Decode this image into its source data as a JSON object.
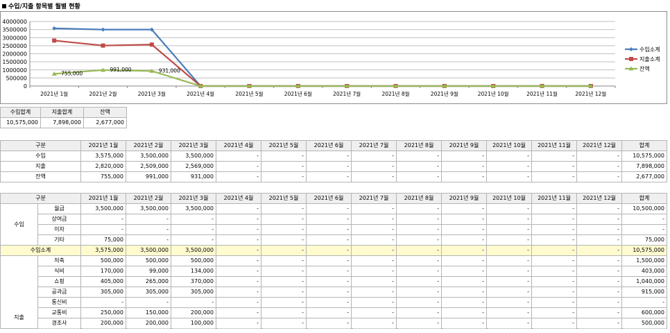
{
  "title": "수입/지출 항목별 월별 현황",
  "chart_data": {
    "type": "line",
    "categories": [
      "2021년 1월",
      "2021년 2월",
      "2021년 3월",
      "2021년 4월",
      "2021년 5월",
      "2021년 6월",
      "2021년 7월",
      "2021년 8월",
      "2021년 9월",
      "2021년 10월",
      "2021년 11월",
      "2021년 12월"
    ],
    "y_ticks": [
      "0",
      "500000",
      "1000000",
      "1500000",
      "2000000",
      "2500000",
      "3000000",
      "3500000",
      "4000000"
    ],
    "ylim": [
      0,
      4000000
    ],
    "grid": true,
    "legend_position": "right",
    "series": [
      {
        "name": "수입소계",
        "color": "#4a7ebb",
        "marker": "diamond",
        "values": [
          3575000,
          3500000,
          3500000,
          0,
          0,
          0,
          0,
          0,
          0,
          0,
          0,
          0
        ]
      },
      {
        "name": "지출소계",
        "color": "#be4b48",
        "marker": "square",
        "values": [
          2820000,
          2509000,
          2569000,
          0,
          0,
          0,
          0,
          0,
          0,
          0,
          0,
          0
        ]
      },
      {
        "name": "잔액",
        "color": "#98b954",
        "marker": "triangle",
        "values": [
          755000,
          991000,
          931000,
          0,
          0,
          0,
          0,
          0,
          0,
          0,
          0,
          0
        ]
      }
    ],
    "data_labels": [
      "755,000",
      "991,000",
      "931,000"
    ]
  },
  "summary": {
    "headers": [
      "수입합계",
      "지출합계",
      "잔액"
    ],
    "values": [
      "10,575,000",
      "7,898,000",
      "2,677,000"
    ]
  },
  "monthly": {
    "headers": [
      "구분",
      "2021년 1월",
      "2021년 2월",
      "2021년 3월",
      "2021년 4월",
      "2021년 5월",
      "2021년 6월",
      "2021년 7월",
      "2021년 8월",
      "2021년 9월",
      "2021년 10월",
      "2021년 11월",
      "2021년 12월",
      "합계"
    ],
    "rows": [
      [
        "수입",
        "3,575,000",
        "3,500,000",
        "3,500,000",
        "-",
        "-",
        "-",
        "-",
        "-",
        "-",
        "-",
        "-",
        "-",
        "10,575,000"
      ],
      [
        "지출",
        "2,820,000",
        "2,509,000",
        "2,569,000",
        "-",
        "-",
        "-",
        "-",
        "-",
        "-",
        "-",
        "-",
        "-",
        "7,898,000"
      ],
      [
        "잔액",
        "755,000",
        "991,000",
        "931,000",
        "-",
        "-",
        "-",
        "-",
        "-",
        "-",
        "-",
        "-",
        "-",
        "2,677,000"
      ]
    ]
  },
  "detail": {
    "headers": [
      "구분",
      "2021년 1월",
      "2021년 2월",
      "2021년 3월",
      "2021년 4월",
      "2021년 5월",
      "2021년 6월",
      "2021년 7월",
      "2021년 8월",
      "2021년 9월",
      "2021년 10월",
      "2021년 11월",
      "2021년 12월",
      "합계"
    ],
    "income_label": "수입",
    "income_rows": [
      [
        "월급",
        "3,500,000",
        "3,500,000",
        "3,500,000",
        "-",
        "-",
        "-",
        "-",
        "-",
        "-",
        "-",
        "-",
        "-",
        "10,500,000"
      ],
      [
        "상여금",
        "-",
        "-",
        "-",
        "-",
        "-",
        "-",
        "-",
        "-",
        "-",
        "-",
        "-",
        "-",
        "-"
      ],
      [
        "이자",
        "-",
        "-",
        "-",
        "-",
        "-",
        "-",
        "-",
        "-",
        "-",
        "-",
        "-",
        "-",
        "-"
      ],
      [
        "기타",
        "75,000",
        "-",
        "-",
        "-",
        "-",
        "-",
        "-",
        "-",
        "-",
        "-",
        "-",
        "-",
        "75,000"
      ]
    ],
    "income_subtotal": [
      "수입소계",
      "3,575,000",
      "3,500,000",
      "3,500,000",
      "-",
      "-",
      "-",
      "-",
      "-",
      "-",
      "-",
      "-",
      "-",
      "10,575,000"
    ],
    "expense_label": "지출",
    "expense_rows": [
      [
        "저축",
        "500,000",
        "500,000",
        "500,000",
        "-",
        "-",
        "-",
        "-",
        "-",
        "-",
        "-",
        "-",
        "-",
        "1,500,000"
      ],
      [
        "식비",
        "170,000",
        "99,000",
        "134,000",
        "-",
        "-",
        "-",
        "-",
        "-",
        "-",
        "-",
        "-",
        "-",
        "403,000"
      ],
      [
        "쇼핑",
        "405,000",
        "265,000",
        "370,000",
        "-",
        "-",
        "-",
        "-",
        "-",
        "-",
        "-",
        "-",
        "-",
        "1,040,000"
      ],
      [
        "공과금",
        "305,000",
        "305,000",
        "305,000",
        "-",
        "-",
        "-",
        "-",
        "-",
        "-",
        "-",
        "-",
        "-",
        "915,000"
      ],
      [
        "통신비",
        "-",
        "-",
        "-",
        "-",
        "-",
        "-",
        "-",
        "-",
        "-",
        "-",
        "-",
        "-",
        "-"
      ],
      [
        "교통비",
        "250,000",
        "150,000",
        "200,000",
        "-",
        "-",
        "-",
        "-",
        "-",
        "-",
        "-",
        "-",
        "-",
        "600,000"
      ],
      [
        "경조사",
        "200,000",
        "200,000",
        "100,000",
        "-",
        "-",
        "-",
        "-",
        "-",
        "-",
        "-",
        "-",
        "-",
        "500,000"
      ]
    ]
  }
}
